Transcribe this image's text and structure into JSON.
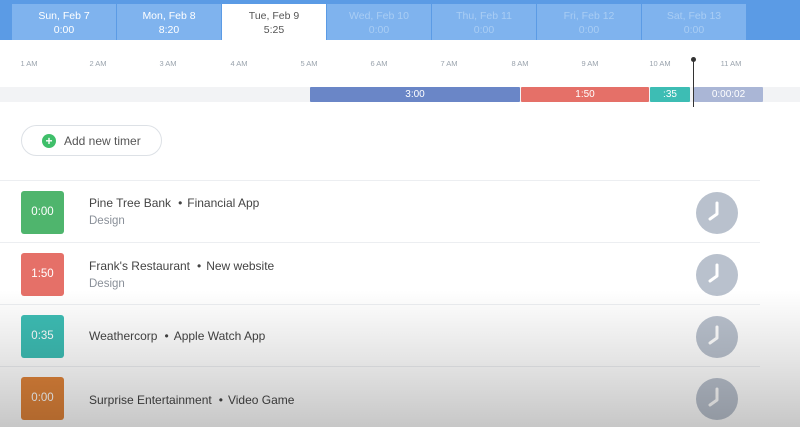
{
  "days": [
    {
      "label": "Sun, Feb 7",
      "time": "0:00",
      "state": "past"
    },
    {
      "label": "Mon, Feb 8",
      "time": "8:20",
      "state": "past"
    },
    {
      "label": "Tue, Feb 9",
      "time": "5:25",
      "state": "active"
    },
    {
      "label": "Wed, Feb 10",
      "time": "0:00",
      "state": "future"
    },
    {
      "label": "Thu, Feb 11",
      "time": "0:00",
      "state": "future"
    },
    {
      "label": "Fri, Feb 12",
      "time": "0:00",
      "state": "future"
    },
    {
      "label": "Sat, Feb 13",
      "time": "0:00",
      "state": "future"
    }
  ],
  "timeline": {
    "hours": [
      "1 AM",
      "2 AM",
      "3 AM",
      "4 AM",
      "5 AM",
      "6 AM",
      "7 AM",
      "8 AM",
      "9 AM",
      "10 AM",
      "11 AM"
    ],
    "segments": [
      {
        "label": "3:00",
        "color": "#6a86c7"
      },
      {
        "label": "1:50",
        "color": "#e57068"
      },
      {
        "label": ":35",
        "color": "#3dbdb4"
      },
      {
        "label": "0:00:02",
        "color": "#aab6d6"
      }
    ]
  },
  "add_timer": {
    "label": "Add new timer",
    "icon": "plus-circle-icon"
  },
  "timers": [
    {
      "duration": "0:00",
      "color": "#4fb56d",
      "client": "Pine Tree Bank",
      "project": "Financial App",
      "task": "Design"
    },
    {
      "duration": "1:50",
      "color": "#e57068",
      "client": "Frank's Restaurant",
      "project": "New website",
      "task": "Design"
    },
    {
      "duration": "0:35",
      "color": "#3dbdb4",
      "client": "Weathercorp",
      "project": "Apple Watch App",
      "task": ""
    },
    {
      "duration": "0:00",
      "color": "#e0843a",
      "client": "Surprise Entertainment",
      "project": "Video Game",
      "task": ""
    }
  ],
  "separator": "•",
  "clock_icon": "clock-icon"
}
